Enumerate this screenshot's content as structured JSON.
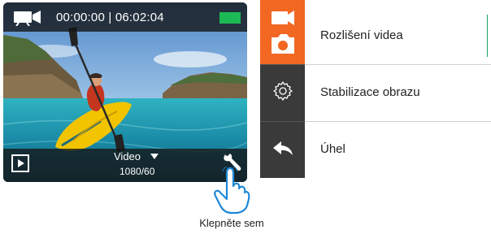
{
  "camera_screen": {
    "timecode": "00:00:00 | 06:02:04",
    "mode_label": "Video",
    "resolution": "1080/60",
    "battery_color": "#1db954",
    "mode_icon": "video-camera-icon",
    "playback_icon": "play-icon",
    "settings_icon": "wrench-icon"
  },
  "tap_hint": {
    "caption": "Klepněte sem",
    "icon": "pointing-hand-icon"
  },
  "settings_menu": {
    "accent_color": "#f26722",
    "items": [
      {
        "label": "Rozlišení videa",
        "icon": "video-photo-mode-icon",
        "active": true
      },
      {
        "label": "Stabilizace obrazu",
        "icon": "gear-icon",
        "active": false
      },
      {
        "label": "Úhel",
        "icon": "back-arrow-icon",
        "active": false
      }
    ]
  }
}
